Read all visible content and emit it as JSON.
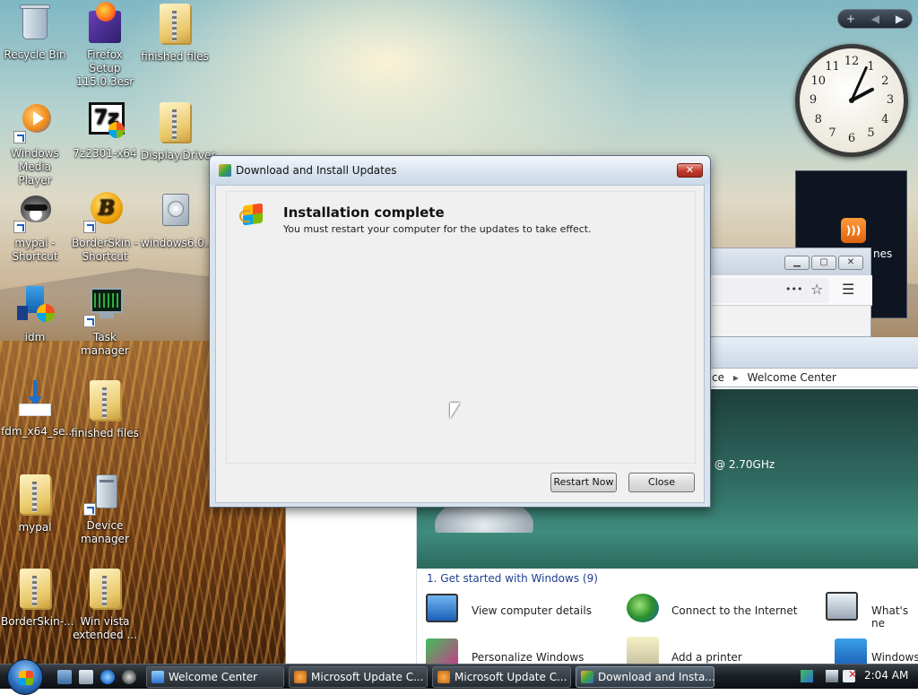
{
  "desktop": {
    "icons": [
      {
        "label": "Recycle Bin"
      },
      {
        "label": "Firefox Setup 115.0.3esr"
      },
      {
        "label": "finished files"
      },
      {
        "label": "Windows Media Player"
      },
      {
        "label": "7z2301-x64"
      },
      {
        "label": "Display.Driver"
      },
      {
        "label": "mypal - Shortcut"
      },
      {
        "label": "BorderSkin - Shortcut"
      },
      {
        "label": "windows6.0..."
      },
      {
        "label": "idm"
      },
      {
        "label": "Task manager"
      },
      {
        "label": "fdm_x64_se..."
      },
      {
        "label": "finished files"
      },
      {
        "label": "mypal"
      },
      {
        "label": "Device manager"
      },
      {
        "label": "BorderSkin-..."
      },
      {
        "label": "Win vista extended ..."
      }
    ]
  },
  "gadgets": {
    "top_bar": {
      "add": "+",
      "prev": "◀",
      "next": "▶"
    },
    "clock_numbers": [
      "12",
      "1",
      "2",
      "3",
      "4",
      "5",
      "6",
      "7",
      "8",
      "9",
      "10",
      "11"
    ],
    "clock_time": {
      "hour": 2,
      "minute": 4
    },
    "feed_partial": "nes"
  },
  "background_windows": {
    "firefox": {
      "menu_dots": "•••",
      "star": "☆",
      "hamburger": "☰"
    },
    "welcome_center": {
      "breadcrumb_left": "ce",
      "breadcrumb_current": "Welcome Center",
      "cpu_text": "@ 2.70GHz",
      "section_header": "1. Get started with Windows (9)",
      "items": [
        {
          "label": "View computer details"
        },
        {
          "label": "Connect to the Internet"
        },
        {
          "label": "What's ne"
        },
        {
          "label": "Personalize Windows"
        },
        {
          "label": "Add a printer"
        },
        {
          "label": "Windows"
        }
      ]
    }
  },
  "dialog": {
    "title": "Download and Install Updates",
    "close_glyph": "✕",
    "heading": "Installation complete",
    "message": "You must restart your computer for the updates to take effect.",
    "restart_label": "Restart Now",
    "close_label": "Close"
  },
  "taskbar": {
    "tasks": [
      {
        "label": "Welcome Center"
      },
      {
        "label": "Microsoft Update C..."
      },
      {
        "label": "Microsoft Update C..."
      },
      {
        "label": "Download and Insta..."
      }
    ],
    "time": "2:04 AM"
  }
}
